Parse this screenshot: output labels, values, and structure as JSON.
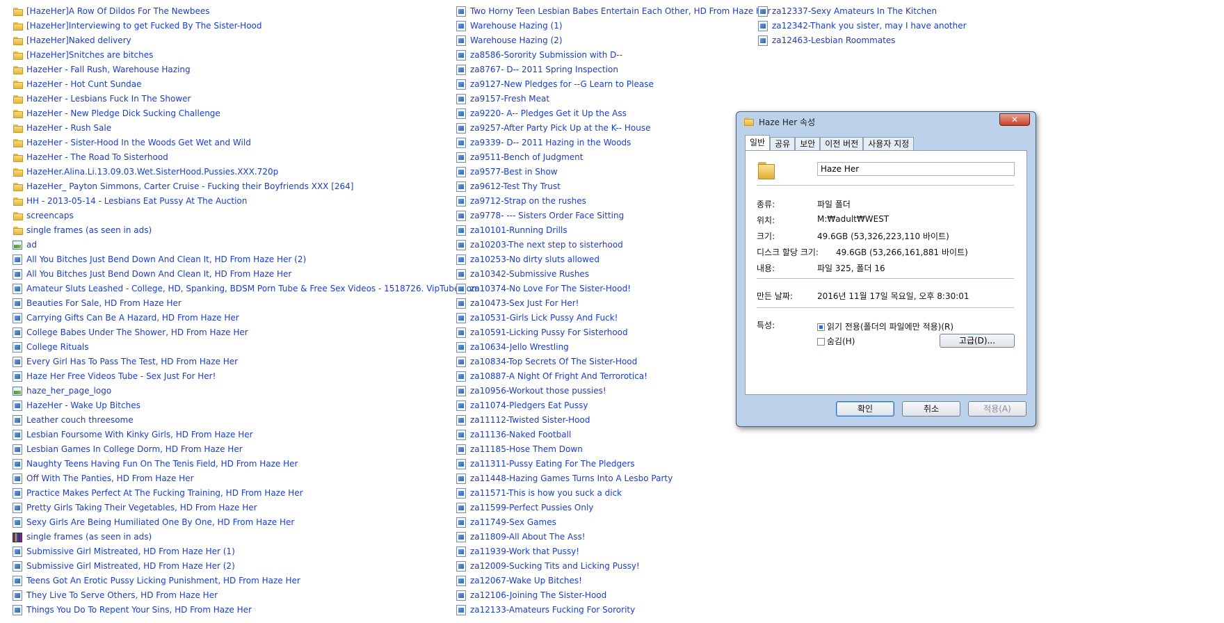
{
  "columns": [
    {
      "items": [
        {
          "icon": "folder",
          "label": "[HazeHer]A Row Of Dildos For The Newbees"
        },
        {
          "icon": "folder",
          "label": "[HazeHer]Interviewing to get Fucked By The Sister-Hood"
        },
        {
          "icon": "folder",
          "label": "[HazeHer]Naked delivery"
        },
        {
          "icon": "folder",
          "label": "[HazeHer]Snitches are bitches"
        },
        {
          "icon": "folder",
          "label": "HazeHer - Fall Rush, Warehouse Hazing"
        },
        {
          "icon": "folder",
          "label": "HazeHer - Hot Cunt Sundae"
        },
        {
          "icon": "folder",
          "label": "HazeHer - Lesbians Fuck In The Shower"
        },
        {
          "icon": "folder",
          "label": "HazeHer - New Pledge Dick Sucking Challenge"
        },
        {
          "icon": "folder",
          "label": "HazeHer - Rush Sale"
        },
        {
          "icon": "folder",
          "label": "HazeHer - Sister-Hood In the Woods Get Wet and Wild"
        },
        {
          "icon": "folder",
          "label": "HazeHer - The Road To Sisterhood"
        },
        {
          "icon": "folder",
          "label": "HazeHer.Alina.Li.13.09.03.Wet.SisterHood.Pussies.XXX.720p"
        },
        {
          "icon": "folder",
          "label": "HazeHer_ Payton Simmons, Carter Cruise - Fucking their Boyfriends XXX [264]"
        },
        {
          "icon": "folder",
          "label": "HH - 2013-05-14 - Lesbians Eat Pussy At The Auction"
        },
        {
          "icon": "folder",
          "label": "screencaps"
        },
        {
          "icon": "folder",
          "label": "single frames (as seen in ads)"
        },
        {
          "icon": "image",
          "label": "ad"
        },
        {
          "icon": "file",
          "label": "All You Bitches Just Bend Down And Clean It, HD  From Haze Her (2)"
        },
        {
          "icon": "file",
          "label": "All You Bitches Just Bend Down And Clean It, HD  From Haze Her"
        },
        {
          "icon": "file",
          "label": "Amateur Sluts Leashed - College, HD, Spanking, BDSM Porn Tube & Free Sex Videos - 1518726. VipTube.com"
        },
        {
          "icon": "file",
          "label": "Beauties For Sale, HD  From Haze Her"
        },
        {
          "icon": "file",
          "label": "Carrying Gifts Can Be A Hazard, HD  From Haze Her"
        },
        {
          "icon": "file",
          "label": "College Babes Under The Shower, HD  From Haze Her"
        },
        {
          "icon": "file",
          "label": "College Rituals"
        },
        {
          "icon": "file",
          "label": "Every Girl Has To Pass The Test, HD  From Haze Her"
        },
        {
          "icon": "file",
          "label": "Haze Her Free Videos Tube - Sex Just For Her!"
        },
        {
          "icon": "image",
          "label": "haze_her_page_logo"
        },
        {
          "icon": "file",
          "label": "HazeHer - Wake Up Bitches"
        },
        {
          "icon": "file",
          "label": "Leather couch threesome"
        },
        {
          "icon": "file",
          "label": "Lesbian Foursome With Kinky Girls, HD  From Haze Her"
        },
        {
          "icon": "file",
          "label": "Lesbian Games In College Dorm, HD  From Haze Her"
        },
        {
          "icon": "file",
          "label": "Naughty Teens Having Fun On The Tenis Field, HD  From Haze Her"
        },
        {
          "icon": "file",
          "label": "Off With The Panties, HD  From Haze Her"
        },
        {
          "icon": "file",
          "label": "Practice Makes Perfect At The Fucking Training, HD  From Haze Her"
        },
        {
          "icon": "file",
          "label": "Pretty Girls Taking Their Vegetables, HD  From Haze Her"
        },
        {
          "icon": "file",
          "label": "Sexy Girls Are Being Humiliated One By One, HD  From Haze Her"
        },
        {
          "icon": "rar",
          "label": "single frames (as seen in ads)"
        },
        {
          "icon": "file",
          "label": "Submissive Girl Mistreated, HD  From Haze Her (1)"
        },
        {
          "icon": "file",
          "label": "Submissive Girl Mistreated, HD  From Haze Her (2)"
        },
        {
          "icon": "file",
          "label": "Teens Got An Erotic Pussy Licking Punishment, HD  From Haze Her"
        },
        {
          "icon": "file",
          "label": "They Live To Serve Others, HD  From Haze Her"
        },
        {
          "icon": "file",
          "label": "Things You Do To Repent Your Sins, HD  From Haze Her"
        }
      ]
    },
    {
      "items": [
        {
          "icon": "file",
          "label": "Two Horny Teen Lesbian Babes Entertain Each Other, HD  From Haze Her"
        },
        {
          "icon": "file",
          "label": "Warehouse Hazing (1)"
        },
        {
          "icon": "file",
          "label": "Warehouse Hazing (2)"
        },
        {
          "icon": "file",
          "label": "za8586-Sorority Submission with D--"
        },
        {
          "icon": "file",
          "label": "za8767- D-- 2011 Spring Inspection"
        },
        {
          "icon": "file",
          "label": "za9127-New Pledges for --G Learn to Please"
        },
        {
          "icon": "file",
          "label": "za9157-Fresh Meat"
        },
        {
          "icon": "file",
          "label": "za9220- A-- Pledges Get it Up the Ass"
        },
        {
          "icon": "file",
          "label": "za9257-After Party Pick Up at the K-- House"
        },
        {
          "icon": "file",
          "label": "za9339- D-- 2011 Hazing in the Woods"
        },
        {
          "icon": "file",
          "label": "za9511-Bench of Judgment"
        },
        {
          "icon": "file",
          "label": "za9577-Best in Show"
        },
        {
          "icon": "file",
          "label": "za9612-Test Thy Trust"
        },
        {
          "icon": "file",
          "label": "za9712-Strap on the rushes"
        },
        {
          "icon": "file",
          "label": "za9778-  --- Sisters Order Face Sitting"
        },
        {
          "icon": "file",
          "label": "za10101-Running Drills"
        },
        {
          "icon": "file",
          "label": "za10203-The next step to sisterhood"
        },
        {
          "icon": "file",
          "label": "za10253-No dirty sluts allowed"
        },
        {
          "icon": "file",
          "label": "za10342-Submissive Rushes"
        },
        {
          "icon": "file",
          "label": "za10374-No Love For The Sister-Hood!"
        },
        {
          "icon": "file",
          "label": "za10473-Sex Just For Her!"
        },
        {
          "icon": "file",
          "label": "za10531-Girls Lick Pussy And Fuck!"
        },
        {
          "icon": "file",
          "label": "za10591-Licking Pussy For Sisterhood"
        },
        {
          "icon": "file",
          "label": "za10634-Jello Wrestling"
        },
        {
          "icon": "file",
          "label": "za10834-Top Secrets Of The Sister-Hood"
        },
        {
          "icon": "file",
          "label": "za10887-A Night Of Fright And Terrorotica!"
        },
        {
          "icon": "file",
          "label": "za10956-Workout those pussies!"
        },
        {
          "icon": "file",
          "label": "za11074-Pledgers Eat Pussy"
        },
        {
          "icon": "file",
          "label": "za11112-Twisted Sister-Hood"
        },
        {
          "icon": "file",
          "label": "za11136-Naked Football"
        },
        {
          "icon": "file",
          "label": "za11185-Hose Them Down"
        },
        {
          "icon": "file",
          "label": "za11311-Pussy Eating For The Pledgers"
        },
        {
          "icon": "file",
          "label": "za11448-Hazing Games Turns Into A Lesbo Party"
        },
        {
          "icon": "file",
          "label": "za11571-This is how you suck a dick"
        },
        {
          "icon": "file",
          "label": "za11599-Perfect Pussies Only"
        },
        {
          "icon": "file",
          "label": "za11749-Sex Games"
        },
        {
          "icon": "file",
          "label": "za11809-All About The Ass!"
        },
        {
          "icon": "file",
          "label": "za11939-Work that Pussy!"
        },
        {
          "icon": "file",
          "label": "za12009-Sucking Tits and Licking Pussy!"
        },
        {
          "icon": "file",
          "label": "za12067-Wake Up Bitches!"
        },
        {
          "icon": "file",
          "label": "za12106-Joining The Sister-Hood"
        },
        {
          "icon": "file",
          "label": "za12133-Amateurs Fucking For Sorority"
        }
      ]
    },
    {
      "items": [
        {
          "icon": "file",
          "label": "za12337-Sexy Amateurs In The Kitchen"
        },
        {
          "icon": "file",
          "label": "za12342-Thank you sister, may I have another"
        },
        {
          "icon": "file",
          "label": "za12463-Lesbian Roommates"
        }
      ]
    }
  ],
  "dialog": {
    "title": "Haze Her 속성",
    "close": "✕",
    "tabs": [
      "일반",
      "공유",
      "보안",
      "이전 버전",
      "사용자 지정"
    ],
    "name_value": "Haze Her",
    "props": {
      "type_label": "종류:",
      "type_value": "파일 폴더",
      "location_label": "위치:",
      "location_value": "M:₩adult₩WEST",
      "size_label": "크기:",
      "size_value": "49.6GB (53,326,223,110 바이트)",
      "disk_label": "디스크 할당 크기:",
      "disk_value": "49.6GB (53,266,161,881 바이트)",
      "contains_label": "내용:",
      "contains_value": "파일 325, 폴더 16",
      "created_label": "만든 날짜:",
      "created_value": "2016년 11월 17일 목요일, 오후 8:30:01",
      "attributes_label": "특성:",
      "readonly_label": "읽기 전용(폴더의 파일에만 적용)(R)",
      "hidden_label": "숨김(H)",
      "advanced_label": "고급(D)..."
    },
    "buttons": {
      "ok": "확인",
      "cancel": "취소",
      "apply": "적용(A)"
    }
  }
}
